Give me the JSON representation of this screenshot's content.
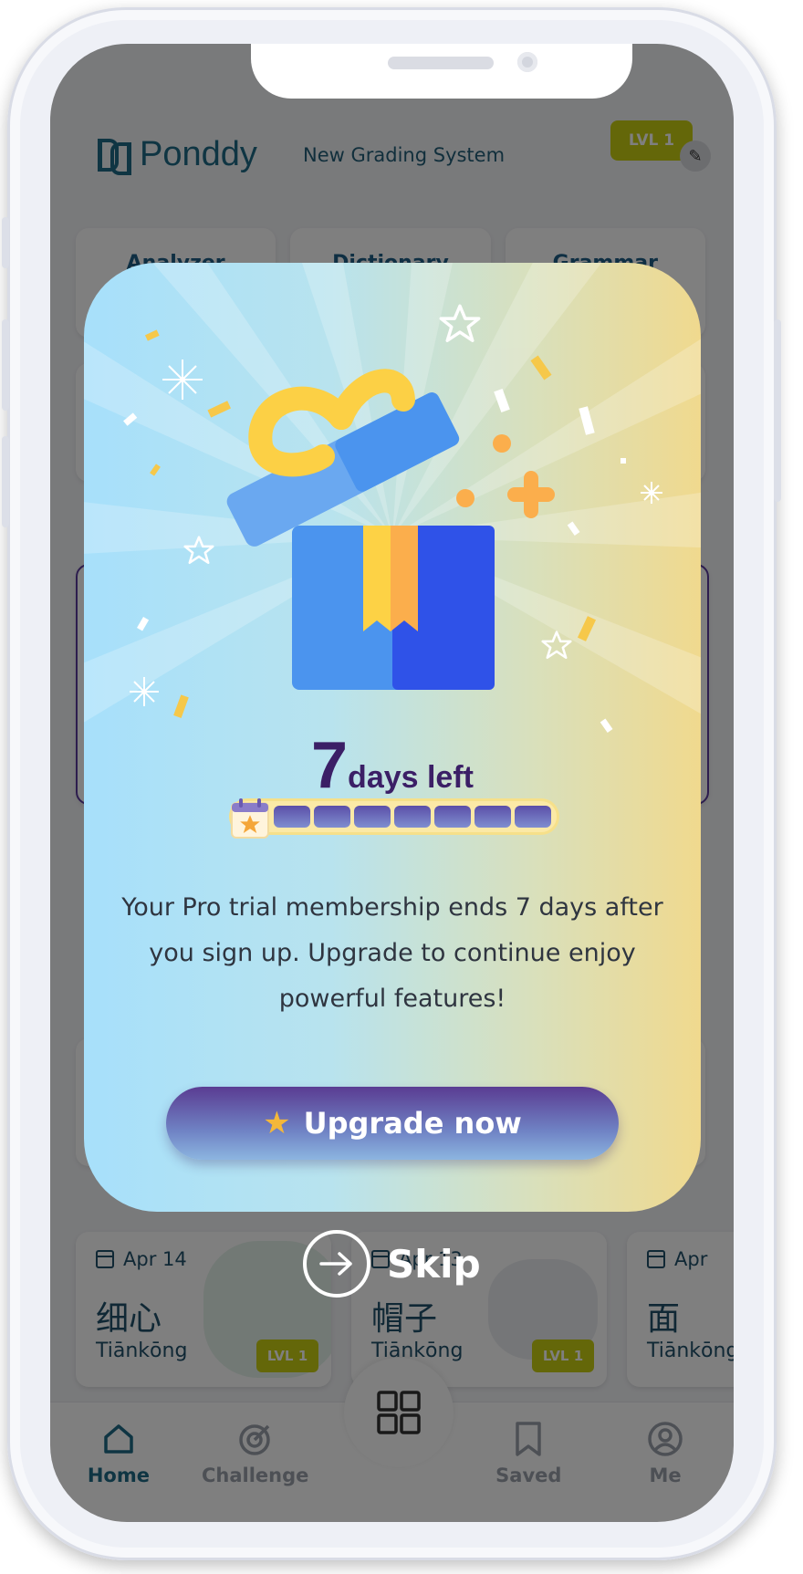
{
  "header": {
    "logo_text": "Ponddy",
    "title": "New Grading System",
    "level_badge": "LVL 1"
  },
  "tools": [
    "Analyzer",
    "Dictionary",
    "Grammar"
  ],
  "word_cards": [
    {
      "date": "Apr 14",
      "hanzi": "细心",
      "pinyin": "Tiānkōng",
      "level": "LVL 1"
    },
    {
      "date": "Apr 13",
      "hanzi": "帽子",
      "pinyin": "Tiānkōng",
      "level": "LVL 1"
    },
    {
      "date": "Apr",
      "hanzi": "面",
      "pinyin": "Tiānkōng",
      "level": ""
    }
  ],
  "nav": [
    {
      "label": "Home",
      "icon": "home-icon",
      "active": true
    },
    {
      "label": "Challenge",
      "icon": "target-icon",
      "active": false
    },
    {
      "label": "",
      "icon": "grid-icon",
      "active": false
    },
    {
      "label": "Saved",
      "icon": "bookmark-icon",
      "active": false
    },
    {
      "label": "Me",
      "icon": "profile-icon",
      "active": false
    }
  ],
  "modal": {
    "days_number": "7",
    "days_label": "days left",
    "trial_progress": 0,
    "trial_total_days": 7,
    "message": "Your Pro trial membership ends 7 days after you sign up. Upgrade to continue enjoy powerful features!",
    "upgrade_label": "Upgrade now",
    "skip_label": "Skip"
  },
  "colors": {
    "brand": "#1f6b86",
    "level_badge": "#c9ce13",
    "modal_text": "#3b1f66",
    "button_top": "#5a3c92",
    "button_bottom": "#8cb5e0"
  }
}
